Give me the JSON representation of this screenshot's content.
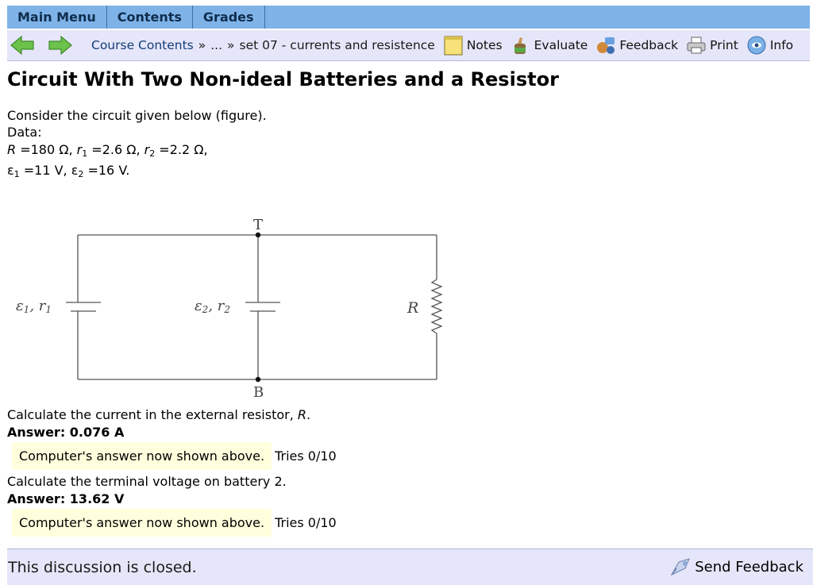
{
  "menu": {
    "tabs": [
      "Main Menu",
      "Contents",
      "Grades"
    ]
  },
  "nav": {
    "back_icon": "back-arrow-icon",
    "forward_icon": "forward-arrow-icon",
    "breadcrumb_link": "Course Contents",
    "breadcrumb_sep1": "»",
    "breadcrumb_ellipsis": "...",
    "breadcrumb_sep2": "»",
    "breadcrumb_current": "set 07 - currents and resistence",
    "tools": [
      "Notes",
      "Evaluate",
      "Feedback",
      "Print",
      "Info"
    ]
  },
  "problem": {
    "title": "Circuit With Two Non-ideal Batteries and a Resistor",
    "intro": "Consider the circuit given below (figure).",
    "data_label": "Data:",
    "line1": {
      "R_sym": "R",
      "R_val": " =180 Ω, ",
      "r_sym": "r",
      "r1_sub": "1",
      "r1_val": " =2.6 Ω, ",
      "r2_sub": "2",
      "r2_val": " =2.2 Ω,"
    },
    "line2": {
      "e_sym": "ε",
      "e1_sub": "1",
      "e1_val": " =11 V, ",
      "e2_sub": "2",
      "e2_val": " =16 V."
    }
  },
  "circuit": {
    "label_T": "T",
    "label_B": "B",
    "label_R": "R",
    "label_e1_sym": "ε",
    "label_e1_sub": "1",
    "label_r1_sym": "r",
    "label_r1_sub": "1",
    "label_e2_sym": "ε",
    "label_e2_sub": "2",
    "label_r2_sym": "r",
    "label_r2_sub": "2",
    "comma": ", "
  },
  "q1": {
    "prompt": "Calculate the current in the external resistor, ",
    "prompt_sym": "R",
    "prompt_end": ".",
    "answer_label": "Answer:",
    "answer_value": "0.076 A",
    "status": "Computer's answer now shown above.",
    "tries": "Tries 0/10"
  },
  "q2": {
    "prompt": "Calculate the terminal voltage on battery 2.",
    "answer_label": "Answer:",
    "answer_value": "13.62 V",
    "status": "Computer's answer now shown above.",
    "tries": "Tries 0/10"
  },
  "footer": {
    "closed_text": "This discussion is closed.",
    "send_feedback": "Send Feedback"
  },
  "colors": {
    "menu_bg": "#7fb3e8",
    "nav_bg": "#e6e6fa",
    "highlight": "#ffffdd",
    "arrow_green": "#6cc24a"
  }
}
